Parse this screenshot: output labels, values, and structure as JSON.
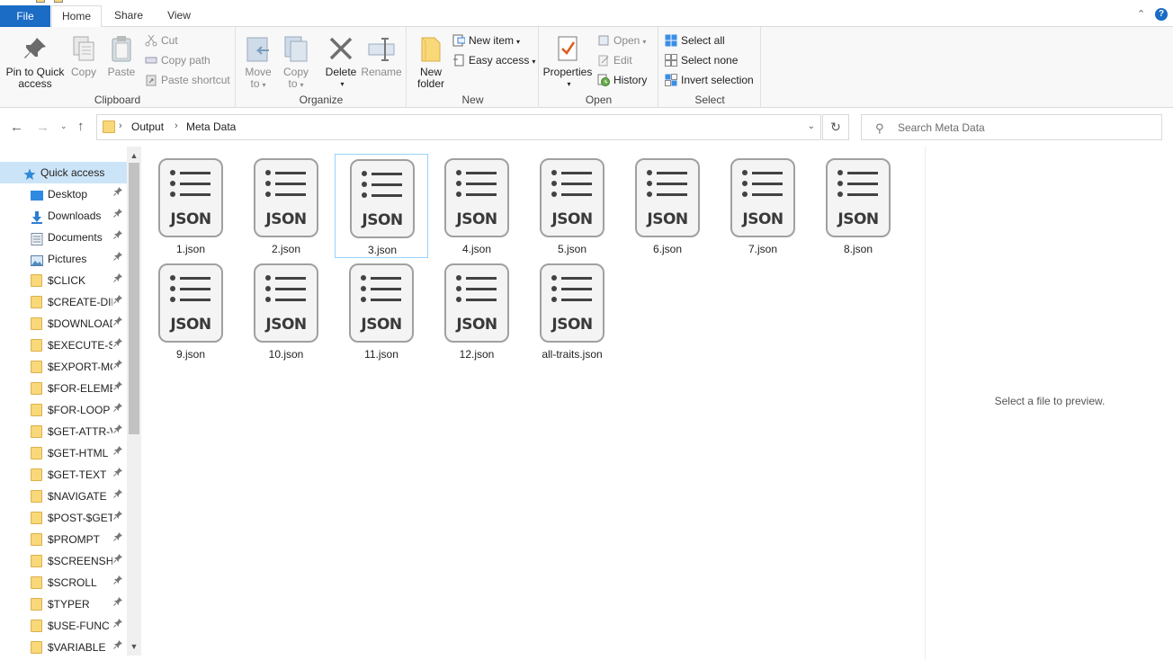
{
  "tabs": {
    "file": "File",
    "home": "Home",
    "share": "Share",
    "view": "View",
    "help": "?"
  },
  "ribbon": {
    "clipboard": {
      "label": "Clipboard",
      "pin_line1": "Pin to Quick",
      "pin_line2": "access",
      "copy": "Copy",
      "paste": "Paste",
      "cut": "Cut",
      "copy_path": "Copy path",
      "paste_shortcut": "Paste shortcut"
    },
    "organize": {
      "label": "Organize",
      "move_line1": "Move",
      "move_line2": "to",
      "copy_line1": "Copy",
      "copy_line2": "to",
      "delete": "Delete",
      "rename": "Rename"
    },
    "new": {
      "label": "New",
      "new_folder_line1": "New",
      "new_folder_line2": "folder",
      "new_item": "New item",
      "easy_access": "Easy access"
    },
    "open": {
      "label": "Open",
      "properties": "Properties",
      "open": "Open",
      "edit": "Edit",
      "history": "History"
    },
    "select": {
      "label": "Select",
      "select_all": "Select all",
      "select_none": "Select none",
      "invert_selection": "Invert selection"
    }
  },
  "address": {
    "crumbs": [
      "Output",
      "Meta Data"
    ],
    "search_placeholder": "Search Meta Data"
  },
  "nav": {
    "items": [
      {
        "label": "Quick access",
        "icon": "star-icon",
        "pinned": false,
        "selected": true
      },
      {
        "label": "Desktop",
        "icon": "desktop-icon",
        "pinned": true
      },
      {
        "label": "Downloads",
        "icon": "download-icon",
        "pinned": true
      },
      {
        "label": "Documents",
        "icon": "documents-icon",
        "pinned": true
      },
      {
        "label": "Pictures",
        "icon": "pictures-icon",
        "pinned": true
      },
      {
        "label": "$CLICK",
        "icon": "folder-icon",
        "pinned": true
      },
      {
        "label": "$CREATE-DIRE",
        "icon": "folder-icon",
        "pinned": true
      },
      {
        "label": "$DOWNLOAD",
        "icon": "folder-icon",
        "pinned": true
      },
      {
        "label": "$EXECUTE-SC",
        "icon": "folder-icon",
        "pinned": true
      },
      {
        "label": "$EXPORT-MO",
        "icon": "folder-icon",
        "pinned": true
      },
      {
        "label": "$FOR-ELEMEI",
        "icon": "folder-icon",
        "pinned": true
      },
      {
        "label": "$FOR-LOOP",
        "icon": "folder-icon",
        "pinned": true
      },
      {
        "label": "$GET-ATTR-V",
        "icon": "folder-icon",
        "pinned": true
      },
      {
        "label": "$GET-HTML",
        "icon": "folder-icon",
        "pinned": true
      },
      {
        "label": "$GET-TEXT",
        "icon": "folder-icon",
        "pinned": true
      },
      {
        "label": "$NAVIGATE",
        "icon": "folder-icon",
        "pinned": true
      },
      {
        "label": "$POST-$GET",
        "icon": "folder-icon",
        "pinned": true
      },
      {
        "label": "$PROMPT",
        "icon": "folder-icon",
        "pinned": true
      },
      {
        "label": "$SCREENSHO",
        "icon": "folder-icon",
        "pinned": true
      },
      {
        "label": "$SCROLL",
        "icon": "folder-icon",
        "pinned": true
      },
      {
        "label": "$TYPER",
        "icon": "folder-icon",
        "pinned": true
      },
      {
        "label": "$USE-FUNC",
        "icon": "folder-icon",
        "pinned": true
      },
      {
        "label": "$VARIABLE",
        "icon": "folder-icon",
        "pinned": true
      }
    ]
  },
  "files": {
    "icon_text": "JSON",
    "items": [
      {
        "name": "1.json",
        "selected": false
      },
      {
        "name": "2.json",
        "selected": false
      },
      {
        "name": "3.json",
        "selected": true
      },
      {
        "name": "4.json",
        "selected": false
      },
      {
        "name": "5.json",
        "selected": false
      },
      {
        "name": "6.json",
        "selected": false
      },
      {
        "name": "7.json",
        "selected": false
      },
      {
        "name": "8.json",
        "selected": false
      },
      {
        "name": "9.json",
        "selected": false
      },
      {
        "name": "10.json",
        "selected": false
      },
      {
        "name": "11.json",
        "selected": false
      },
      {
        "name": "12.json",
        "selected": false
      },
      {
        "name": "all-traits.json",
        "selected": false
      }
    ]
  },
  "preview": {
    "message": "Select a file to preview."
  },
  "colors": {
    "accent": "#1a6cc4",
    "selection": "#cce4f7",
    "folder": "#f9d87a"
  }
}
